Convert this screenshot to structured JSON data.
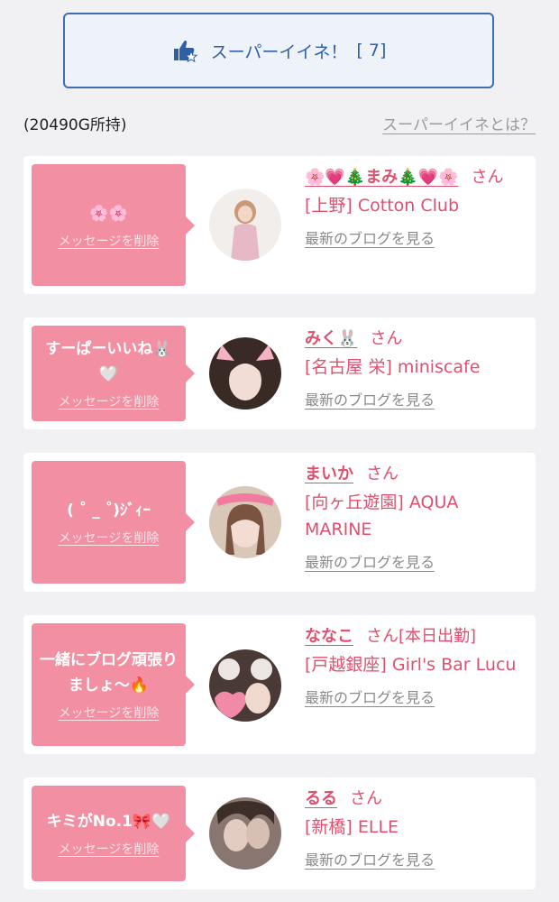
{
  "super_like": {
    "label": "スーパーイイネ！",
    "count": "[ 7]"
  },
  "gold_text": "(20490G所持)",
  "what_is_link": "スーパーイイネとは？",
  "delete_label": "メッセージを削除",
  "blog_link": "最新のブログを見る",
  "san_suffix": "さん",
  "cards": [
    {
      "message": "🌸🌸",
      "name": "🌸💗🎄まみ🎄💗🌸",
      "shop": "[上野] Cotton Club"
    },
    {
      "message": "すーぱーいいね🐰🤍",
      "name": "みく🐰",
      "shop": "[名古屋 栄] miniscafe"
    },
    {
      "message": "( ˚ _ ˚)ｼﾞｨｰ",
      "name": "まいか",
      "shop": "[向ヶ丘遊園] AQUA MARINE"
    },
    {
      "message": "一緒にブログ頑張りましょ〜🔥",
      "name": "ななこ",
      "extra": "[本日出勤]",
      "shop": "[戸越銀座] Girl's Bar Lucu"
    },
    {
      "message": "キミがNo.1🎀🤍",
      "name": "るる",
      "shop": "[新橋] ELLE"
    }
  ]
}
